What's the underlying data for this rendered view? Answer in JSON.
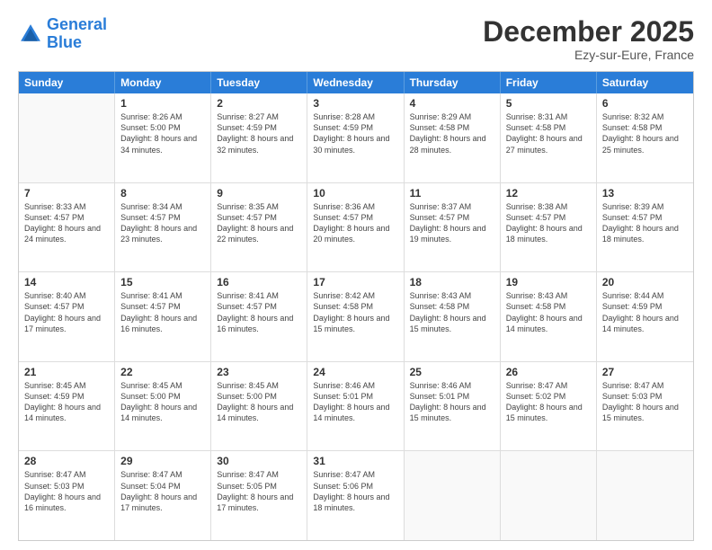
{
  "logo": {
    "line1": "General",
    "line2": "Blue"
  },
  "header": {
    "month": "December 2025",
    "location": "Ezy-sur-Eure, France"
  },
  "days": [
    "Sunday",
    "Monday",
    "Tuesday",
    "Wednesday",
    "Thursday",
    "Friday",
    "Saturday"
  ],
  "weeks": [
    [
      {
        "day": "",
        "sunrise": "",
        "sunset": "",
        "daylight": ""
      },
      {
        "day": "1",
        "sunrise": "Sunrise: 8:26 AM",
        "sunset": "Sunset: 5:00 PM",
        "daylight": "Daylight: 8 hours and 34 minutes."
      },
      {
        "day": "2",
        "sunrise": "Sunrise: 8:27 AM",
        "sunset": "Sunset: 4:59 PM",
        "daylight": "Daylight: 8 hours and 32 minutes."
      },
      {
        "day": "3",
        "sunrise": "Sunrise: 8:28 AM",
        "sunset": "Sunset: 4:59 PM",
        "daylight": "Daylight: 8 hours and 30 minutes."
      },
      {
        "day": "4",
        "sunrise": "Sunrise: 8:29 AM",
        "sunset": "Sunset: 4:58 PM",
        "daylight": "Daylight: 8 hours and 28 minutes."
      },
      {
        "day": "5",
        "sunrise": "Sunrise: 8:31 AM",
        "sunset": "Sunset: 4:58 PM",
        "daylight": "Daylight: 8 hours and 27 minutes."
      },
      {
        "day": "6",
        "sunrise": "Sunrise: 8:32 AM",
        "sunset": "Sunset: 4:58 PM",
        "daylight": "Daylight: 8 hours and 25 minutes."
      }
    ],
    [
      {
        "day": "7",
        "sunrise": "Sunrise: 8:33 AM",
        "sunset": "Sunset: 4:57 PM",
        "daylight": "Daylight: 8 hours and 24 minutes."
      },
      {
        "day": "8",
        "sunrise": "Sunrise: 8:34 AM",
        "sunset": "Sunset: 4:57 PM",
        "daylight": "Daylight: 8 hours and 23 minutes."
      },
      {
        "day": "9",
        "sunrise": "Sunrise: 8:35 AM",
        "sunset": "Sunset: 4:57 PM",
        "daylight": "Daylight: 8 hours and 22 minutes."
      },
      {
        "day": "10",
        "sunrise": "Sunrise: 8:36 AM",
        "sunset": "Sunset: 4:57 PM",
        "daylight": "Daylight: 8 hours and 20 minutes."
      },
      {
        "day": "11",
        "sunrise": "Sunrise: 8:37 AM",
        "sunset": "Sunset: 4:57 PM",
        "daylight": "Daylight: 8 hours and 19 minutes."
      },
      {
        "day": "12",
        "sunrise": "Sunrise: 8:38 AM",
        "sunset": "Sunset: 4:57 PM",
        "daylight": "Daylight: 8 hours and 18 minutes."
      },
      {
        "day": "13",
        "sunrise": "Sunrise: 8:39 AM",
        "sunset": "Sunset: 4:57 PM",
        "daylight": "Daylight: 8 hours and 18 minutes."
      }
    ],
    [
      {
        "day": "14",
        "sunrise": "Sunrise: 8:40 AM",
        "sunset": "Sunset: 4:57 PM",
        "daylight": "Daylight: 8 hours and 17 minutes."
      },
      {
        "day": "15",
        "sunrise": "Sunrise: 8:41 AM",
        "sunset": "Sunset: 4:57 PM",
        "daylight": "Daylight: 8 hours and 16 minutes."
      },
      {
        "day": "16",
        "sunrise": "Sunrise: 8:41 AM",
        "sunset": "Sunset: 4:57 PM",
        "daylight": "Daylight: 8 hours and 16 minutes."
      },
      {
        "day": "17",
        "sunrise": "Sunrise: 8:42 AM",
        "sunset": "Sunset: 4:58 PM",
        "daylight": "Daylight: 8 hours and 15 minutes."
      },
      {
        "day": "18",
        "sunrise": "Sunrise: 8:43 AM",
        "sunset": "Sunset: 4:58 PM",
        "daylight": "Daylight: 8 hours and 15 minutes."
      },
      {
        "day": "19",
        "sunrise": "Sunrise: 8:43 AM",
        "sunset": "Sunset: 4:58 PM",
        "daylight": "Daylight: 8 hours and 14 minutes."
      },
      {
        "day": "20",
        "sunrise": "Sunrise: 8:44 AM",
        "sunset": "Sunset: 4:59 PM",
        "daylight": "Daylight: 8 hours and 14 minutes."
      }
    ],
    [
      {
        "day": "21",
        "sunrise": "Sunrise: 8:45 AM",
        "sunset": "Sunset: 4:59 PM",
        "daylight": "Daylight: 8 hours and 14 minutes."
      },
      {
        "day": "22",
        "sunrise": "Sunrise: 8:45 AM",
        "sunset": "Sunset: 5:00 PM",
        "daylight": "Daylight: 8 hours and 14 minutes."
      },
      {
        "day": "23",
        "sunrise": "Sunrise: 8:45 AM",
        "sunset": "Sunset: 5:00 PM",
        "daylight": "Daylight: 8 hours and 14 minutes."
      },
      {
        "day": "24",
        "sunrise": "Sunrise: 8:46 AM",
        "sunset": "Sunset: 5:01 PM",
        "daylight": "Daylight: 8 hours and 14 minutes."
      },
      {
        "day": "25",
        "sunrise": "Sunrise: 8:46 AM",
        "sunset": "Sunset: 5:01 PM",
        "daylight": "Daylight: 8 hours and 15 minutes."
      },
      {
        "day": "26",
        "sunrise": "Sunrise: 8:47 AM",
        "sunset": "Sunset: 5:02 PM",
        "daylight": "Daylight: 8 hours and 15 minutes."
      },
      {
        "day": "27",
        "sunrise": "Sunrise: 8:47 AM",
        "sunset": "Sunset: 5:03 PM",
        "daylight": "Daylight: 8 hours and 15 minutes."
      }
    ],
    [
      {
        "day": "28",
        "sunrise": "Sunrise: 8:47 AM",
        "sunset": "Sunset: 5:03 PM",
        "daylight": "Daylight: 8 hours and 16 minutes."
      },
      {
        "day": "29",
        "sunrise": "Sunrise: 8:47 AM",
        "sunset": "Sunset: 5:04 PM",
        "daylight": "Daylight: 8 hours and 17 minutes."
      },
      {
        "day": "30",
        "sunrise": "Sunrise: 8:47 AM",
        "sunset": "Sunset: 5:05 PM",
        "daylight": "Daylight: 8 hours and 17 minutes."
      },
      {
        "day": "31",
        "sunrise": "Sunrise: 8:47 AM",
        "sunset": "Sunset: 5:06 PM",
        "daylight": "Daylight: 8 hours and 18 minutes."
      },
      {
        "day": "",
        "sunrise": "",
        "sunset": "",
        "daylight": ""
      },
      {
        "day": "",
        "sunrise": "",
        "sunset": "",
        "daylight": ""
      },
      {
        "day": "",
        "sunrise": "",
        "sunset": "",
        "daylight": ""
      }
    ]
  ]
}
